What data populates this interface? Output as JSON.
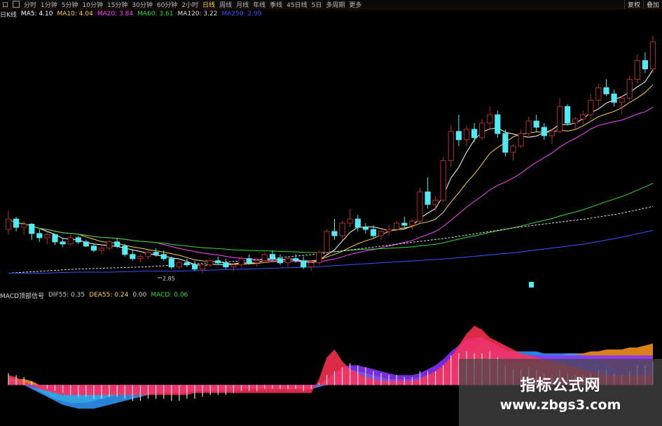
{
  "toolbar": {
    "left_box_label": "口",
    "periods": [
      "分时",
      "1分钟",
      "5分钟",
      "10分钟",
      "15分钟",
      "30分钟",
      "60分钟",
      "2小时",
      "日线",
      "周线",
      "月线",
      "年线",
      "季线",
      "45日线",
      "5日",
      "多周期",
      "更多"
    ],
    "active_period": "日线",
    "right_buttons": [
      "复权",
      "叠加"
    ]
  },
  "price_legend": {
    "name": "日K线",
    "items": [
      {
        "label": "MA5: 4.10",
        "color": "#ffffff"
      },
      {
        "label": "MA10: 4.04",
        "color": "#ffd24a"
      },
      {
        "label": "MA20: 3.84",
        "color": "#ff44ff"
      },
      {
        "label": "MA60: 3.61",
        "color": "#33dd33"
      },
      {
        "label": "MA120: 3.22",
        "color": "#dddddd"
      },
      {
        "label": "MA250: 2.99",
        "color": "#3355ff"
      }
    ]
  },
  "indicator_legend": {
    "name": "MACD顶部信号",
    "items": [
      {
        "label": "DIF55: 0.35",
        "color": "#cccccc"
      },
      {
        "label": "DEA55: 0.24",
        "color": "#ffd24a"
      },
      {
        "label": "0.00",
        "color": "#cccccc"
      },
      {
        "label": "MACD: 0.06",
        "color": "#33dd33"
      }
    ]
  },
  "annotations": {
    "low_price": "2.85"
  },
  "watermark": {
    "line1": "指标公式网",
    "line2": "www.zbgs3.com"
  },
  "colors": {
    "up": "#b03030",
    "down": "#55e8f0",
    "ma5": "#ffffff",
    "ma10": "#ffd24a",
    "ma20": "#ff44ff",
    "ma60": "#33dd33",
    "ma120": "#dddddd",
    "ma250": "#3355ff"
  },
  "chart_data": {
    "type": "candlestick",
    "candles": [
      [
        3.0,
        3.18,
        2.95,
        3.1
      ],
      [
        3.1,
        3.12,
        2.98,
        3.02
      ],
      [
        3.02,
        3.08,
        2.95,
        3.05
      ],
      [
        3.05,
        3.06,
        2.9,
        2.96
      ],
      [
        2.96,
        3.0,
        2.88,
        2.92
      ],
      [
        2.92,
        2.98,
        2.86,
        2.95
      ],
      [
        2.95,
        2.96,
        2.85,
        2.88
      ],
      [
        2.88,
        2.92,
        2.83,
        2.86
      ],
      [
        2.86,
        2.95,
        2.84,
        2.92
      ],
      [
        2.92,
        2.94,
        2.86,
        2.88
      ],
      [
        2.88,
        2.9,
        2.83,
        2.84
      ],
      [
        2.84,
        2.86,
        2.78,
        2.8
      ],
      [
        2.8,
        2.84,
        2.76,
        2.82
      ],
      [
        2.82,
        2.9,
        2.8,
        2.88
      ],
      [
        2.88,
        2.92,
        2.82,
        2.84
      ],
      [
        2.84,
        2.86,
        2.74,
        2.76
      ],
      [
        2.76,
        2.8,
        2.7,
        2.72
      ],
      [
        2.72,
        2.76,
        2.68,
        2.74
      ],
      [
        2.74,
        2.8,
        2.72,
        2.78
      ],
      [
        2.78,
        2.82,
        2.74,
        2.76
      ],
      [
        2.76,
        2.8,
        2.7,
        2.72
      ],
      [
        2.72,
        2.74,
        2.62,
        2.64
      ],
      [
        2.64,
        2.7,
        2.62,
        2.68
      ],
      [
        2.68,
        2.72,
        2.64,
        2.66
      ],
      [
        2.66,
        2.7,
        2.6,
        2.62
      ],
      [
        2.62,
        2.68,
        2.58,
        2.66
      ],
      [
        2.66,
        2.72,
        2.64,
        2.7
      ],
      [
        2.7,
        2.74,
        2.66,
        2.68
      ],
      [
        2.68,
        2.72,
        2.62,
        2.64
      ],
      [
        2.64,
        2.68,
        2.6,
        2.66
      ],
      [
        2.66,
        2.74,
        2.64,
        2.72
      ],
      [
        2.72,
        2.76,
        2.66,
        2.68
      ],
      [
        2.68,
        2.72,
        2.64,
        2.7
      ],
      [
        2.7,
        2.78,
        2.68,
        2.76
      ],
      [
        2.76,
        2.8,
        2.7,
        2.72
      ],
      [
        2.72,
        2.76,
        2.66,
        2.68
      ],
      [
        2.68,
        2.74,
        2.64,
        2.72
      ],
      [
        2.72,
        2.76,
        2.68,
        2.7
      ],
      [
        2.7,
        2.74,
        2.62,
        2.64
      ],
      [
        2.64,
        2.7,
        2.6,
        2.68
      ],
      [
        2.68,
        2.8,
        2.66,
        2.78
      ],
      [
        2.78,
        3.0,
        2.76,
        2.98
      ],
      [
        2.98,
        3.1,
        2.9,
        2.94
      ],
      [
        2.94,
        3.08,
        2.9,
        3.06
      ],
      [
        3.06,
        3.2,
        3.02,
        3.1
      ],
      [
        3.1,
        3.14,
        2.98,
        3.02
      ],
      [
        3.02,
        3.06,
        2.96,
        3.0
      ],
      [
        3.0,
        3.04,
        2.92,
        2.94
      ],
      [
        2.94,
        3.0,
        2.9,
        2.98
      ],
      [
        2.98,
        3.04,
        2.94,
        3.0
      ],
      [
        3.0,
        3.08,
        2.98,
        3.06
      ],
      [
        3.06,
        3.12,
        3.02,
        3.04
      ],
      [
        3.04,
        3.1,
        3.0,
        3.08
      ],
      [
        3.08,
        3.4,
        3.06,
        3.36
      ],
      [
        3.36,
        3.5,
        3.2,
        3.24
      ],
      [
        3.24,
        3.32,
        3.18,
        3.28
      ],
      [
        3.28,
        3.7,
        3.26,
        3.66
      ],
      [
        3.66,
        4.0,
        3.6,
        3.94
      ],
      [
        3.94,
        4.1,
        3.8,
        3.86
      ],
      [
        3.86,
        4.0,
        3.8,
        3.96
      ],
      [
        3.96,
        4.02,
        3.84,
        3.88
      ],
      [
        3.88,
        4.06,
        3.86,
        4.02
      ],
      [
        4.02,
        4.18,
        3.96,
        4.1
      ],
      [
        4.1,
        4.14,
        3.88,
        3.92
      ],
      [
        3.92,
        3.96,
        3.7,
        3.74
      ],
      [
        3.74,
        3.82,
        3.66,
        3.8
      ],
      [
        3.8,
        3.96,
        3.78,
        3.92
      ],
      [
        3.92,
        4.08,
        3.88,
        4.04
      ],
      [
        4.04,
        4.1,
        3.94,
        3.98
      ],
      [
        3.98,
        4.02,
        3.86,
        3.9
      ],
      [
        3.9,
        3.96,
        3.82,
        3.94
      ],
      [
        3.94,
        4.26,
        3.92,
        4.18
      ],
      [
        4.18,
        4.2,
        4.0,
        4.02
      ],
      [
        4.02,
        4.08,
        3.96,
        4.06
      ],
      [
        4.06,
        4.14,
        4.0,
        4.1
      ],
      [
        4.1,
        4.3,
        4.06,
        4.24
      ],
      [
        4.24,
        4.4,
        4.18,
        4.36
      ],
      [
        4.36,
        4.44,
        4.28,
        4.3
      ],
      [
        4.3,
        4.34,
        4.18,
        4.22
      ],
      [
        4.22,
        4.28,
        4.1,
        4.26
      ],
      [
        4.26,
        4.48,
        4.24,
        4.44
      ],
      [
        4.44,
        4.68,
        4.4,
        4.62
      ],
      [
        4.62,
        4.7,
        4.5,
        4.54
      ],
      [
        4.54,
        4.86,
        4.5,
        4.8
      ]
    ],
    "yrange": [
      2.55,
      5.0
    ],
    "ma_windows": [
      5,
      10,
      20,
      60
    ],
    "ma_long": {
      "MA120": [
        2.58,
        2.6,
        2.62,
        2.63,
        2.64,
        2.66,
        2.68,
        2.7,
        2.73,
        2.76,
        2.8,
        2.84,
        2.88,
        2.92,
        2.97,
        3.02,
        3.06,
        3.1,
        3.15,
        3.22
      ],
      "MA250": [
        2.58,
        2.58,
        2.59,
        2.59,
        2.6,
        2.6,
        2.61,
        2.62,
        2.63,
        2.64,
        2.66,
        2.68,
        2.7,
        2.72,
        2.75,
        2.78,
        2.82,
        2.86,
        2.92,
        2.99
      ]
    },
    "macd_hist": [
      0.06,
      0.05,
      0.04,
      0.02,
      0.0,
      -0.02,
      -0.03,
      -0.04,
      -0.05,
      -0.06,
      -0.06,
      -0.07,
      -0.07,
      -0.06,
      -0.06,
      -0.07,
      -0.08,
      -0.08,
      -0.07,
      -0.07,
      -0.07,
      -0.08,
      -0.08,
      -0.07,
      -0.07,
      -0.06,
      -0.05,
      -0.05,
      -0.05,
      -0.04,
      -0.03,
      -0.03,
      -0.03,
      -0.02,
      -0.02,
      -0.02,
      -0.02,
      -0.02,
      -0.03,
      -0.02,
      0.01,
      0.05,
      0.07,
      0.09,
      0.11,
      0.1,
      0.09,
      0.07,
      0.06,
      0.05,
      0.05,
      0.04,
      0.04,
      0.07,
      0.07,
      0.07,
      0.1,
      0.15,
      0.16,
      0.17,
      0.16,
      0.16,
      0.17,
      0.14,
      0.1,
      0.08,
      0.08,
      0.09,
      0.08,
      0.06,
      0.05,
      0.08,
      0.06,
      0.05,
      0.05,
      0.06,
      0.08,
      0.08,
      0.06,
      0.05,
      0.07,
      0.1,
      0.1,
      0.12
    ],
    "bands": [
      {
        "color": "#ff9922",
        "values": [
          0.02,
          0.03,
          0.03,
          0.02,
          0.0,
          -0.02,
          -0.03,
          -0.04,
          -0.05,
          -0.05,
          -0.05,
          -0.05,
          -0.04,
          -0.04,
          -0.04,
          -0.04,
          -0.04,
          -0.04,
          -0.04,
          -0.03,
          -0.03,
          -0.03,
          -0.03,
          -0.03,
          -0.03,
          -0.02,
          -0.02,
          -0.02,
          -0.02,
          -0.02,
          -0.01,
          -0.01,
          -0.01,
          -0.01,
          -0.01,
          -0.01,
          -0.01,
          -0.01,
          -0.01,
          -0.01,
          0.0,
          0.01,
          0.02,
          0.03,
          0.04,
          0.04,
          0.04,
          0.04,
          0.03,
          0.03,
          0.03,
          0.03,
          0.03,
          0.04,
          0.05,
          0.05,
          0.06,
          0.08,
          0.1,
          0.12,
          0.13,
          0.14,
          0.15,
          0.15,
          0.15,
          0.15,
          0.15,
          0.15,
          0.15,
          0.15,
          0.15,
          0.15,
          0.16,
          0.16,
          0.16,
          0.17,
          0.17,
          0.18,
          0.18,
          0.18,
          0.19,
          0.19,
          0.2,
          0.21
        ]
      },
      {
        "color": "#33ff33",
        "values": [
          0.04,
          0.03,
          0.01,
          -0.01,
          -0.03,
          -0.05,
          -0.07,
          -0.08,
          -0.09,
          -0.09,
          -0.09,
          -0.08,
          -0.07,
          -0.06,
          -0.05,
          -0.04,
          -0.03,
          -0.02,
          -0.02,
          -0.02,
          -0.02,
          -0.02,
          -0.02,
          -0.02,
          -0.02,
          -0.02,
          -0.02,
          -0.02,
          -0.02,
          -0.02,
          -0.02,
          -0.02,
          -0.02,
          -0.02,
          -0.02,
          -0.02,
          -0.02,
          -0.02,
          -0.02,
          -0.02,
          0.0,
          0.03,
          0.05,
          0.07,
          0.08,
          0.07,
          0.06,
          0.05,
          0.04,
          0.03,
          0.02,
          0.01,
          0.01,
          0.02,
          0.03,
          0.04,
          0.06,
          0.08,
          0.1,
          0.14,
          0.18,
          0.22,
          0.2,
          0.14,
          0.08,
          0.04,
          0.02,
          0.02,
          0.02,
          0.02,
          0.02,
          0.02,
          0.02,
          0.02,
          0.02,
          0.02,
          0.02,
          0.02,
          0.02,
          0.02,
          0.02,
          0.02,
          0.02,
          0.02
        ]
      },
      {
        "color": "#3399ff",
        "values": [
          0.03,
          0.02,
          0.0,
          -0.02,
          -0.04,
          -0.06,
          -0.08,
          -0.1,
          -0.11,
          -0.12,
          -0.12,
          -0.12,
          -0.11,
          -0.1,
          -0.09,
          -0.08,
          -0.07,
          -0.06,
          -0.05,
          -0.04,
          -0.03,
          -0.03,
          -0.03,
          -0.03,
          -0.03,
          -0.03,
          -0.03,
          -0.03,
          -0.02,
          -0.02,
          -0.02,
          -0.02,
          -0.02,
          -0.02,
          -0.02,
          -0.02,
          -0.02,
          -0.02,
          -0.02,
          -0.02,
          -0.01,
          0.0,
          0.01,
          0.02,
          0.02,
          0.02,
          0.02,
          0.02,
          0.02,
          0.02,
          0.02,
          0.02,
          0.02,
          0.02,
          0.03,
          0.03,
          0.04,
          0.05,
          0.06,
          0.08,
          0.1,
          0.13,
          0.16,
          0.17,
          0.17,
          0.17,
          0.17,
          0.17,
          0.17,
          0.16,
          0.16,
          0.16,
          0.16,
          0.16,
          0.15,
          0.14,
          0.12,
          0.1,
          0.08,
          0.06,
          0.05,
          0.05,
          0.05,
          0.05
        ]
      },
      {
        "color": "#8833ff",
        "values": [
          0.02,
          0.01,
          0.0,
          -0.01,
          -0.02,
          -0.03,
          -0.04,
          -0.05,
          -0.05,
          -0.05,
          -0.05,
          -0.05,
          -0.05,
          -0.04,
          -0.04,
          -0.04,
          -0.04,
          -0.04,
          -0.04,
          -0.04,
          -0.04,
          -0.04,
          -0.04,
          -0.04,
          -0.03,
          -0.03,
          -0.03,
          -0.03,
          -0.03,
          -0.03,
          -0.02,
          -0.02,
          -0.02,
          -0.02,
          -0.02,
          -0.02,
          -0.02,
          -0.02,
          -0.02,
          -0.02,
          0.0,
          0.03,
          0.06,
          0.09,
          0.1,
          0.1,
          0.09,
          0.08,
          0.07,
          0.06,
          0.05,
          0.05,
          0.05,
          0.06,
          0.08,
          0.1,
          0.13,
          0.17,
          0.2,
          0.23,
          0.24,
          0.24,
          0.22,
          0.2,
          0.18,
          0.16,
          0.15,
          0.15,
          0.15,
          0.15,
          0.15,
          0.15,
          0.15,
          0.15,
          0.15,
          0.15,
          0.15,
          0.15,
          0.15,
          0.15,
          0.15,
          0.15,
          0.15,
          0.15
        ]
      },
      {
        "color": "#ff3355",
        "values": [
          0.05,
          0.04,
          0.02,
          0.0,
          -0.02,
          -0.03,
          -0.04,
          -0.05,
          -0.05,
          -0.05,
          -0.05,
          -0.05,
          -0.05,
          -0.05,
          -0.05,
          -0.05,
          -0.05,
          -0.05,
          -0.05,
          -0.05,
          -0.05,
          -0.05,
          -0.05,
          -0.05,
          -0.04,
          -0.04,
          -0.04,
          -0.04,
          -0.04,
          -0.04,
          -0.04,
          -0.04,
          -0.04,
          -0.04,
          -0.04,
          -0.04,
          -0.04,
          -0.04,
          -0.04,
          -0.04,
          0.03,
          0.14,
          0.18,
          0.12,
          0.08,
          0.06,
          0.04,
          0.03,
          0.02,
          0.02,
          0.02,
          0.02,
          0.02,
          0.03,
          0.05,
          0.07,
          0.1,
          0.14,
          0.2,
          0.26,
          0.3,
          0.28,
          0.24,
          0.22,
          0.2,
          0.18,
          0.16,
          0.15,
          0.14,
          0.13,
          0.12,
          0.11,
          0.1,
          0.09,
          0.08,
          0.07,
          0.06,
          0.05,
          0.05,
          0.05,
          0.05,
          0.05,
          0.05,
          0.05
        ]
      }
    ],
    "macd_range": [
      -0.14,
      0.32
    ]
  }
}
